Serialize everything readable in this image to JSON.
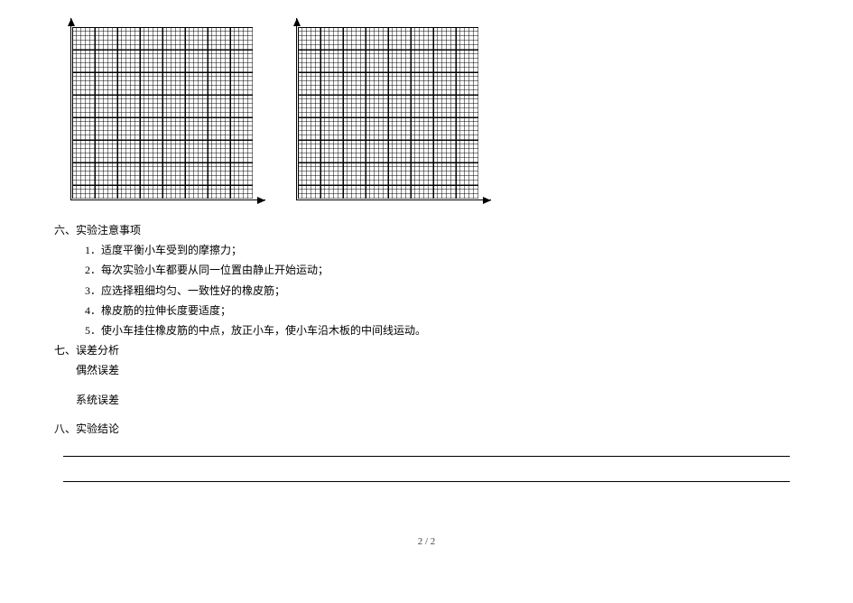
{
  "sections": {
    "six": {
      "title": "六、实验注意事项",
      "items": [
        "1．适度平衡小车受到的摩擦力；",
        "2．每次实验小车都要从同一位置由静止开始运动；",
        "3．应选择粗细均匀、一致性好的橡皮筋；",
        "4．橡皮筋的拉伸长度要适度；",
        "5．使小车挂住橡皮筋的中点，放正小车，使小车沿木板的中间线运动。"
      ]
    },
    "seven": {
      "title": "七、误差分析",
      "sub1": "偶然误差",
      "sub2": "系统误差"
    },
    "eight": {
      "title": "八、实验结论"
    }
  },
  "pagenum": "2 / 2"
}
